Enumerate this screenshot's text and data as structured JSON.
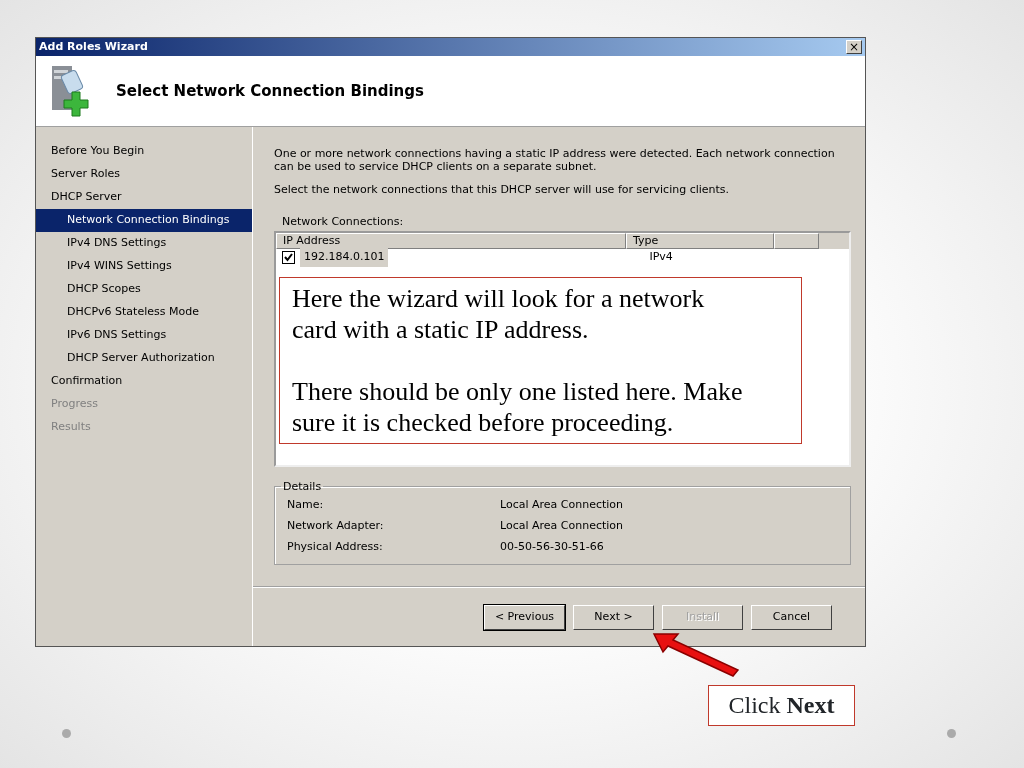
{
  "window": {
    "title": "Add Roles Wizard",
    "close": "×"
  },
  "header": {
    "title": "Select Network Connection Bindings"
  },
  "steps": [
    {
      "label": "Before You Begin",
      "selected": false,
      "disabled": false
    },
    {
      "label": "Server Roles",
      "selected": false,
      "disabled": false
    },
    {
      "label": "DHCP Server",
      "selected": false,
      "disabled": false,
      "children": [
        {
          "label": "Network Connection Bindings",
          "selected": true,
          "disabled": false
        },
        {
          "label": "IPv4 DNS Settings",
          "selected": false,
          "disabled": false
        },
        {
          "label": "IPv4 WINS Settings",
          "selected": false,
          "disabled": false
        },
        {
          "label": "DHCP Scopes",
          "selected": false,
          "disabled": false
        },
        {
          "label": "DHCPv6 Stateless Mode",
          "selected": false,
          "disabled": false
        },
        {
          "label": "IPv6 DNS Settings",
          "selected": false,
          "disabled": false
        },
        {
          "label": "DHCP Server Authorization",
          "selected": false,
          "disabled": false
        }
      ]
    },
    {
      "label": "Confirmation",
      "selected": false,
      "disabled": false
    },
    {
      "label": "Progress",
      "selected": false,
      "disabled": true
    },
    {
      "label": "Results",
      "selected": false,
      "disabled": true
    }
  ],
  "intro": [
    "One or more network connections having a static IP address were detected. Each network connection can be used to service DHCP clients on a separate subnet.",
    "Select the network connections that this DHCP server will use for servicing clients."
  ],
  "connections": {
    "label": "Network Connections:",
    "columns": [
      "IP Address",
      "Type"
    ],
    "rows": [
      {
        "checked": true,
        "selected": true,
        "ip": "192.184.0.101",
        "type": "IPv4"
      }
    ]
  },
  "callout": [
    "Here the wizard will look for a network card with a static IP address.",
    "There should be only one listed here. Make sure it is checked before proceeding."
  ],
  "details": {
    "title": "Details",
    "rows": [
      {
        "label": "Name:",
        "value": "Local Area Connection"
      },
      {
        "label": "Network Adapter:",
        "value": "Local Area Connection"
      },
      {
        "label": "Physical Address:",
        "value": "00-50-56-30-51-66"
      }
    ]
  },
  "buttons": [
    {
      "label": "< Previous",
      "disabled": false,
      "default": true
    },
    {
      "label": "Next >",
      "disabled": false,
      "default": false
    },
    {
      "label": "Install",
      "disabled": true,
      "default": false
    },
    {
      "label": "Cancel",
      "disabled": false,
      "default": false
    }
  ],
  "slide_note": "Click **Next**"
}
